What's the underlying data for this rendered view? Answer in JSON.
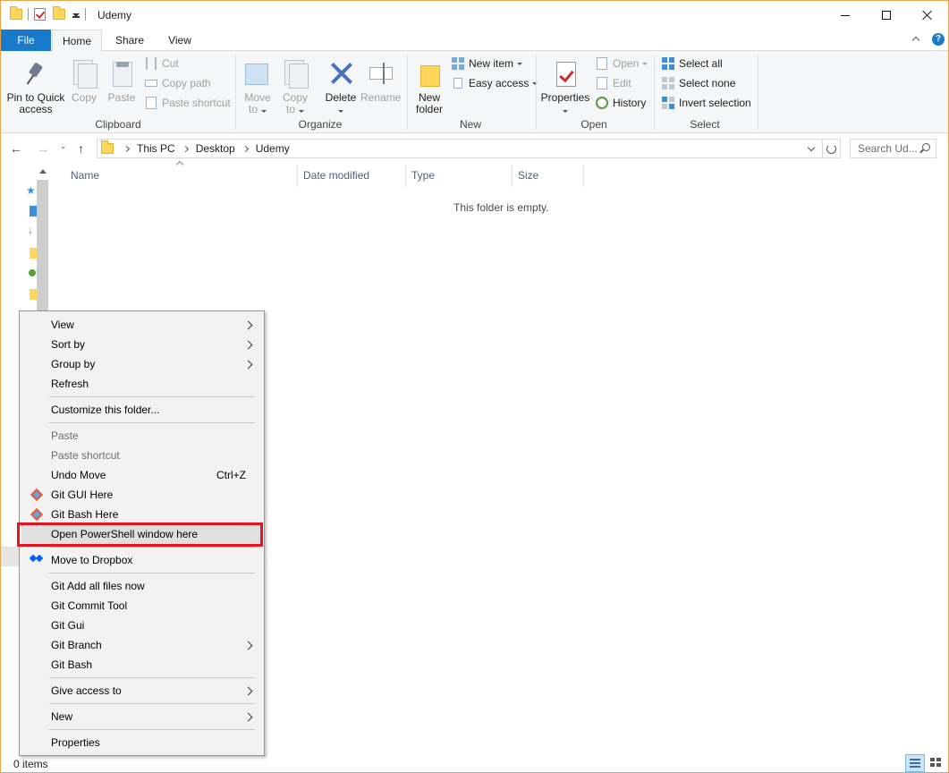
{
  "window": {
    "title": "Udemy",
    "accent": "#1979ca",
    "highlight_color": "#e5131c"
  },
  "ribbon": {
    "tabs": [
      {
        "label": "File"
      },
      {
        "label": "Home"
      },
      {
        "label": "Share"
      },
      {
        "label": "View"
      }
    ],
    "clipboard": {
      "group_label": "Clipboard",
      "pin_label_1": "Pin to Quick",
      "pin_label_2": "access",
      "copy": "Copy",
      "paste": "Paste",
      "cut": "Cut",
      "copy_path": "Copy path",
      "paste_shortcut": "Paste shortcut"
    },
    "organize": {
      "group_label": "Organize",
      "move_to_1": "Move",
      "move_to_2": "to",
      "copy_to_1": "Copy",
      "copy_to_2": "to",
      "delete": "Delete",
      "rename": "Rename"
    },
    "new": {
      "group_label": "New",
      "new_folder_1": "New",
      "new_folder_2": "folder",
      "new_item": "New item",
      "easy_access": "Easy access"
    },
    "open": {
      "group_label": "Open",
      "properties": "Properties",
      "open": "Open",
      "edit": "Edit",
      "history": "History"
    },
    "select": {
      "group_label": "Select",
      "select_all": "Select all",
      "select_none": "Select none",
      "invert_selection": "Invert selection"
    }
  },
  "address": {
    "crumbs": [
      "This PC",
      "Desktop",
      "Udemy"
    ],
    "search_placeholder": "Search Ud..."
  },
  "filelist": {
    "columns": [
      "Name",
      "Date modified",
      "Type",
      "Size"
    ],
    "empty_message": "This folder is empty."
  },
  "status": {
    "item_count": "0 items"
  },
  "context_menu": {
    "items": [
      {
        "label": "View",
        "submenu": true
      },
      {
        "label": "Sort by",
        "submenu": true
      },
      {
        "label": "Group by",
        "submenu": true
      },
      {
        "label": "Refresh"
      },
      {
        "label": "Customize this folder..."
      },
      {
        "label": "Paste",
        "disabled": true
      },
      {
        "label": "Paste shortcut",
        "disabled": true
      },
      {
        "label": "Undo Move",
        "shortcut": "Ctrl+Z"
      },
      {
        "label": "Git GUI Here",
        "icon": "git-icon"
      },
      {
        "label": "Git Bash Here",
        "icon": "git-icon"
      },
      {
        "label": "Open PowerShell window here",
        "highlighted": true
      },
      {
        "label": "Move to Dropbox",
        "icon": "dropbox-icon"
      },
      {
        "label": "Git Add all files now"
      },
      {
        "label": "Git Commit Tool"
      },
      {
        "label": "Git Gui"
      },
      {
        "label": "Git Branch",
        "submenu": true
      },
      {
        "label": "Git Bash"
      },
      {
        "label": "Give access to",
        "submenu": true
      },
      {
        "label": "New",
        "submenu": true
      },
      {
        "label": "Properties"
      }
    ]
  }
}
